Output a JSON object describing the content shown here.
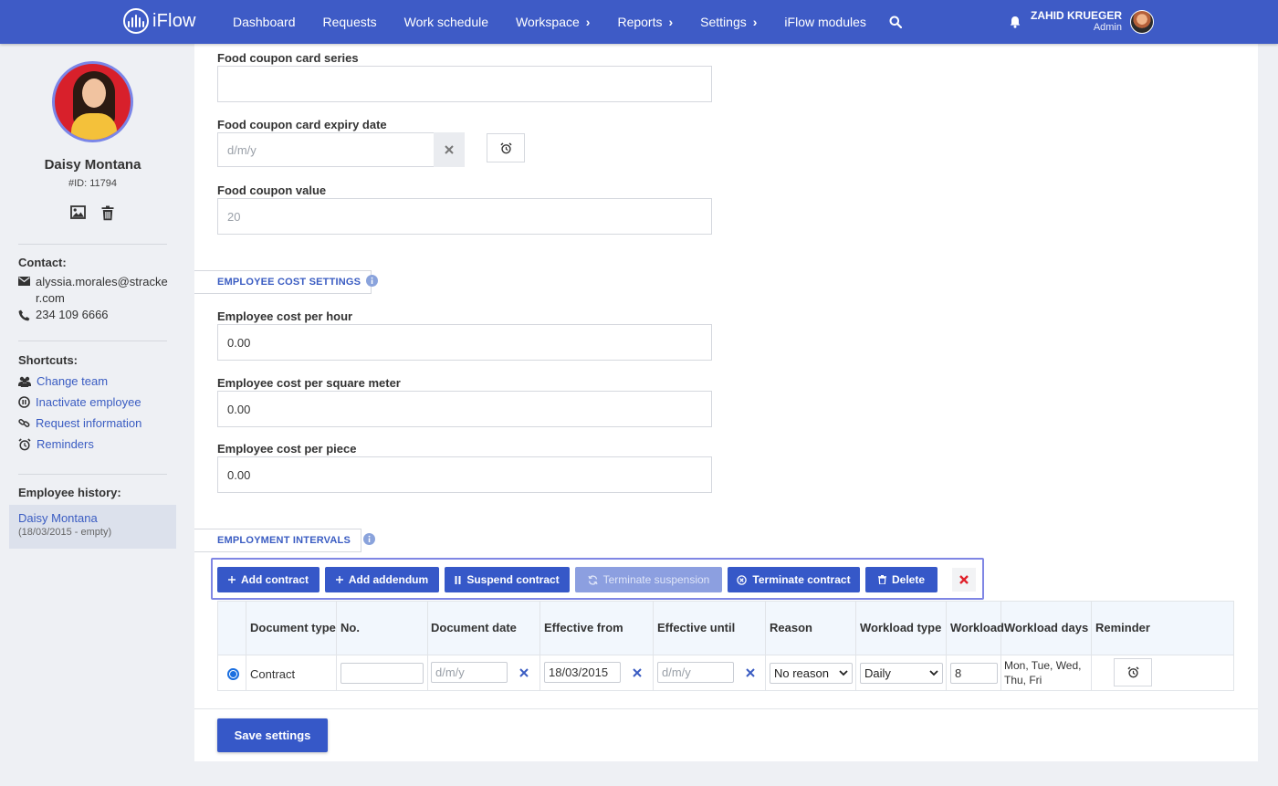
{
  "navbar": {
    "logo_text": "iFlow",
    "items": [
      {
        "label": "Dashboard",
        "has_submenu": false
      },
      {
        "label": "Requests",
        "has_submenu": false
      },
      {
        "label": "Work schedule",
        "has_submenu": false
      },
      {
        "label": "Workspace",
        "has_submenu": true
      },
      {
        "label": "Reports",
        "has_submenu": true
      },
      {
        "label": "Settings",
        "has_submenu": true
      },
      {
        "label": "iFlow modules",
        "has_submenu": false
      }
    ],
    "user_name": "ZAHID KRUEGER",
    "user_role": "Admin",
    "icons": [
      "search-icon",
      "bell-icon"
    ]
  },
  "sidebar": {
    "employee_name": "Daisy Montana",
    "employee_id": "#ID: 11794",
    "contact_heading": "Contact:",
    "email": "alyssia.morales@stracker.com",
    "phone": "234 109 6666",
    "shortcuts_heading": "Shortcuts:",
    "shortcuts": [
      {
        "label": "Change team",
        "icon": "users-icon"
      },
      {
        "label": "Inactivate employee",
        "icon": "pause-circle-icon"
      },
      {
        "label": "Request information",
        "icon": "link-icon"
      },
      {
        "label": "Reminders",
        "icon": "alarm-clock-icon"
      }
    ],
    "history_heading": "Employee history:",
    "history_item": {
      "name": "Daisy Montana",
      "dates": "(18/03/2015 - empty)"
    }
  },
  "form": {
    "food_coupon_series_label": "Food coupon card series",
    "food_coupon_series_value": "",
    "food_coupon_expiry_label": "Food coupon card expiry date",
    "food_coupon_expiry_placeholder": "d/m/y",
    "food_coupon_value_label": "Food coupon value",
    "food_coupon_value_placeholder": "20",
    "cost_section_title": "EMPLOYEE COST SETTINGS",
    "cost_per_hour_label": "Employee cost per hour",
    "cost_per_hour_value": "0.00",
    "cost_per_sqm_label": "Employee cost per square meter",
    "cost_per_sqm_value": "0.00",
    "cost_per_piece_label": "Employee cost per piece",
    "cost_per_piece_value": "0.00",
    "intervals_section_title": "EMPLOYMENT INTERVALS"
  },
  "toolbar": {
    "add_contract": "Add contract",
    "add_addendum": "Add addendum",
    "suspend_contract": "Suspend contract",
    "terminate_suspension": "Terminate suspension",
    "terminate_contract": "Terminate contract",
    "delete": "Delete"
  },
  "table": {
    "columns": [
      "Document type",
      "No.",
      "Document date",
      "Effective from",
      "Effective until",
      "Reason",
      "Workload type",
      "Workload",
      "Workload days",
      "Reminder"
    ],
    "row": {
      "selected": true,
      "document_type": "Contract",
      "number": "",
      "document_date_placeholder": "d/m/y",
      "effective_from": "18/03/2015",
      "effective_until_placeholder": "d/m/y",
      "reason": "No reason",
      "workload_type": "Daily",
      "workload": "8",
      "workload_days": "Mon, Tue, Wed, Thu, Fri"
    }
  },
  "save_label": "Save settings",
  "colors": {
    "navbar": "#3e5bc6",
    "primary_button": "#3658c8",
    "disabled_button": "#8c9fe0",
    "link": "#3a5cc2",
    "toolbar_outline": "#7f86e4",
    "delete_red": "#e0202a"
  }
}
